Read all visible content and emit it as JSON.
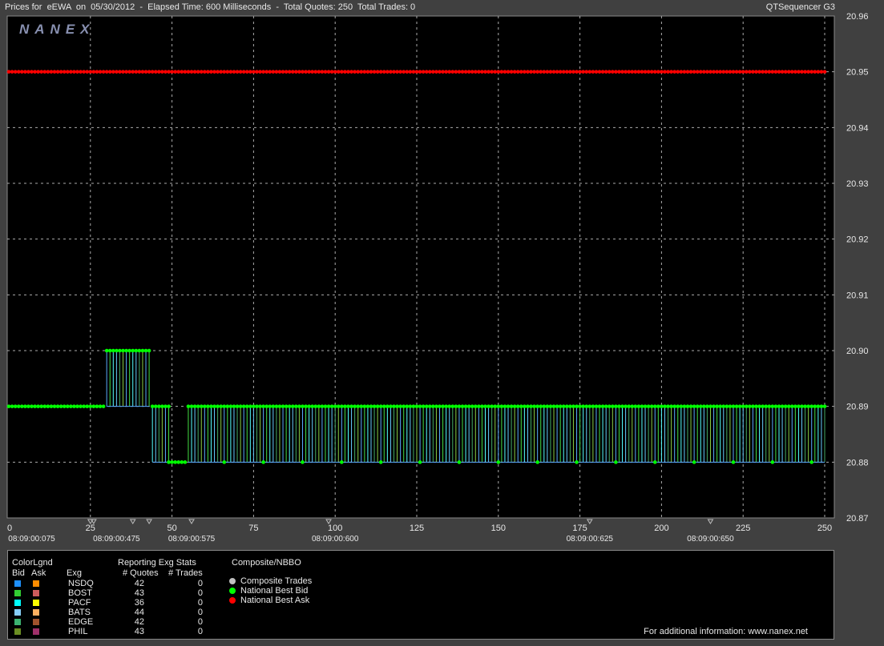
{
  "header": {
    "title": "Prices for  eEWA  on  05/30/2012  -  Elapsed Time: 600 Milliseconds  -  Total Quotes: 250  Total Trades: 0",
    "product": "QTSequencer G3"
  },
  "logo_text": "NANEX",
  "chart_data": {
    "type": "line",
    "title": "Prices for  eEWA  on  05/30/2012  -  Elapsed Time: 600 Milliseconds  -  Total Quotes: 250  Total Trades: 0",
    "xlim": [
      0,
      250
    ],
    "ylim": [
      20.87,
      20.96
    ],
    "x_ticks": [
      0,
      25,
      50,
      75,
      100,
      125,
      150,
      175,
      200,
      225,
      250
    ],
    "y_ticks": [
      20.87,
      20.88,
      20.89,
      20.9,
      20.91,
      20.92,
      20.93,
      20.94,
      20.95,
      20.96
    ],
    "y_tick_labels": [
      "20.87",
      "20.88",
      "20.89",
      "20.90",
      "20.91",
      "20.92",
      "20.93",
      "20.94",
      "20.95",
      "20.96"
    ],
    "time_labels": [
      {
        "x": 7,
        "label": "08:09:00:075"
      },
      {
        "x": 33,
        "label": "08:09:00:475"
      },
      {
        "x": 56,
        "label": "08:09:00:575"
      },
      {
        "x": 100,
        "label": "08:09:00:600"
      },
      {
        "x": 178,
        "label": "08:09:00:625"
      },
      {
        "x": 215,
        "label": "08:09:00:650"
      }
    ],
    "time_markers": [
      25,
      26,
      38,
      43,
      56,
      98,
      178,
      215
    ],
    "grid": true,
    "best_ask": {
      "name": "National Best Ask",
      "color": "#ff0000",
      "segments": [
        {
          "from": 0,
          "to": 250,
          "price": 20.95
        }
      ]
    },
    "best_bid": {
      "name": "National Best Bid",
      "color": "#00ff00",
      "segments": [
        {
          "from": 0,
          "to": 29,
          "price": 20.89
        },
        {
          "from": 30,
          "to": 43,
          "price": 20.9
        },
        {
          "from": 44,
          "to": 49,
          "price": 20.89
        },
        {
          "from": 49,
          "to": 54,
          "price": 20.88
        },
        {
          "from": 55,
          "to": 250,
          "price": 20.89
        }
      ],
      "low_points": [
        66,
        78,
        90,
        102,
        114,
        126,
        138,
        150,
        162,
        174,
        186,
        198,
        210,
        222,
        234,
        246
      ]
    },
    "exchange_quote_stems": {
      "range": [
        30,
        250
      ],
      "top_price_by_segment": [
        {
          "from": 30,
          "to": 43,
          "top": 20.9,
          "bottom": 20.89
        },
        {
          "from": 44,
          "to": 49,
          "top": 20.89,
          "bottom": 20.88
        },
        {
          "from": 55,
          "to": 250,
          "top": 20.89,
          "bottom": 20.88
        }
      ],
      "colors": [
        "#5aa9ff",
        "#44dd44",
        "#55ffff",
        "#66ccff",
        "#44aa66",
        "#88cc44"
      ]
    }
  },
  "legend": {
    "color_legend_title": "ColorLgnd",
    "bid_header": "Bid",
    "ask_header": "Ask",
    "exg_header": "Exg",
    "stats_title": "Reporting Exg Stats",
    "quotes_header": "# Quotes",
    "trades_header": "# Trades",
    "composite_title": "Composite/NBBO",
    "rows": [
      {
        "exg": "NSDQ",
        "quotes": "42",
        "trades": "0",
        "bid_color": "#1e90ff",
        "ask_color": "#ff8c00"
      },
      {
        "exg": "BOST",
        "quotes": "43",
        "trades": "0",
        "bid_color": "#32cd32",
        "ask_color": "#cd5c5c"
      },
      {
        "exg": "PACF",
        "quotes": "36",
        "trades": "0",
        "bid_color": "#00ffff",
        "ask_color": "#ffff00"
      },
      {
        "exg": "BATS",
        "quotes": "44",
        "trades": "0",
        "bid_color": "#87cefa",
        "ask_color": "#ffb060"
      },
      {
        "exg": "EDGE",
        "quotes": "42",
        "trades": "0",
        "bid_color": "#3cb371",
        "ask_color": "#a0522d"
      },
      {
        "exg": "PHIL",
        "quotes": "43",
        "trades": "0",
        "bid_color": "#6b8e23",
        "ask_color": "#a0306a"
      }
    ],
    "composite_items": [
      {
        "label": "Composite Trades",
        "color": "#c0c0c0"
      },
      {
        "label": "National Best Bid",
        "color": "#00ff00"
      },
      {
        "label": "National Best Ask",
        "color": "#ff0000"
      }
    ],
    "footer": "For additional information: www.nanex.net"
  }
}
